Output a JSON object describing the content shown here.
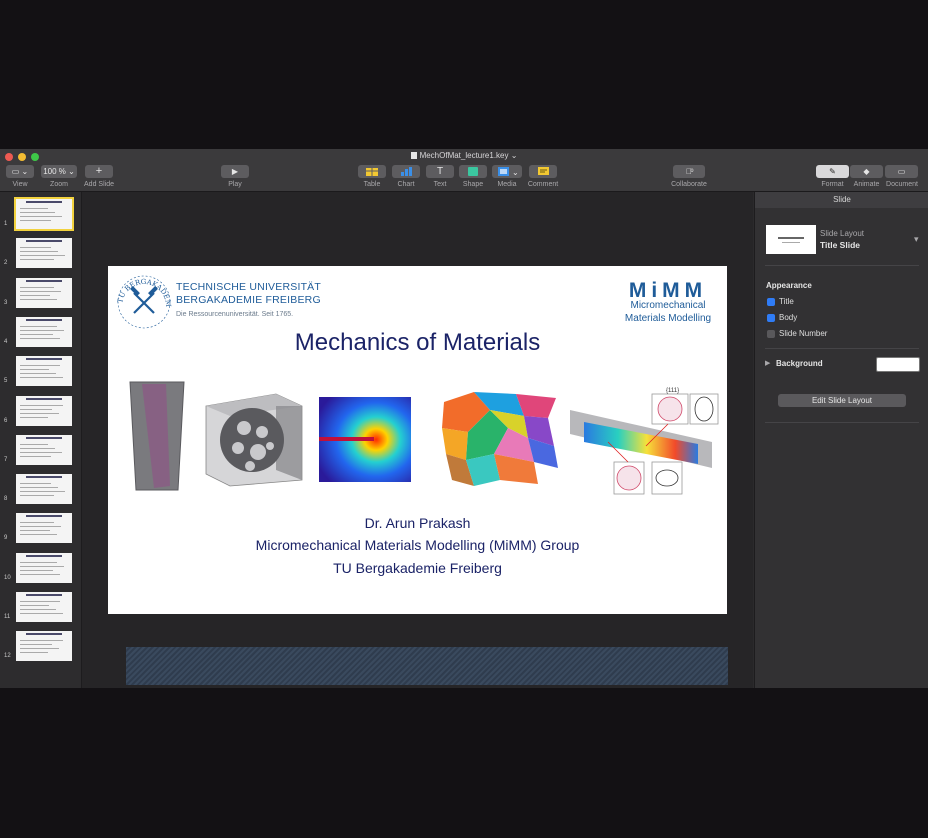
{
  "window": {
    "title": "MechOfMat_lecture1.key"
  },
  "toolbar": {
    "view_label": "View",
    "zoom_value": "100 %",
    "zoom_label": "Zoom",
    "add_slide_label": "Add Slide",
    "play_label": "Play",
    "table_label": "Table",
    "chart_label": "Chart",
    "text_label": "Text",
    "shape_label": "Shape",
    "media_label": "Media",
    "comment_label": "Comment",
    "collaborate_label": "Collaborate",
    "format_label": "Format",
    "animate_label": "Animate",
    "document_label": "Document"
  },
  "navigator": {
    "slide_numbers": [
      "1",
      "2",
      "3",
      "4",
      "5",
      "6",
      "7",
      "8",
      "9",
      "10",
      "11",
      "12"
    ]
  },
  "slide": {
    "university_line1": "TECHNISCHE UNIVERSITÄT",
    "university_line2": "BERGAKADEMIE FREIBERG",
    "university_tagline": "Die Ressourcenuniversität. Seit 1765.",
    "seal_text": "TU BERGAKADEMIE FREIBERG",
    "group_logo": "MiMM",
    "group_line1": "Micromechanical",
    "group_line2": "Materials Modelling",
    "title": "Mechanics of Materials",
    "author": "Dr. Arun Prakash",
    "group_name": "Micromechanical Materials Modelling (MiMM) Group",
    "institution": "TU Bergakademie Freiberg",
    "figure_label": "{111}"
  },
  "sidebar": {
    "tab_label": "Slide",
    "layout_label": "Slide Layout",
    "layout_name": "Title Slide",
    "appearance_heading": "Appearance",
    "title_checkbox_label": "Title",
    "body_checkbox_label": "Body",
    "slide_number_checkbox_label": "Slide Number",
    "title_checked": true,
    "body_checked": true,
    "slide_number_checked": false,
    "background_label": "Background",
    "background_color": "#ffffff",
    "edit_layout_button": "Edit Slide Layout"
  },
  "colors": {
    "accent": "#2f7cf6",
    "slide_title": "#1b2367",
    "tu_blue": "#1f5c99",
    "selection": "#f2d23e"
  }
}
